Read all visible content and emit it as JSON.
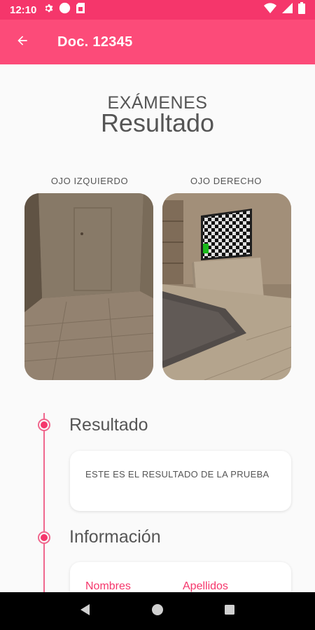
{
  "status_bar": {
    "time": "12:10",
    "left_icons": [
      "gear-icon",
      "circle-icon",
      "sim-card-icon"
    ],
    "right_icons": [
      "wifi-icon",
      "signal-icon",
      "battery-icon"
    ]
  },
  "app_bar": {
    "title": "Doc. 12345",
    "back_icon": "arrow-back-icon",
    "color": "#fc4b79",
    "status_color": "#f5366b"
  },
  "header": {
    "subtitle": "EXÁMENES",
    "title": "Resultado"
  },
  "eyes": {
    "left_label": "OJO IZQUIERDO",
    "right_label": "OJO DERECHO"
  },
  "timeline": {
    "accent": "#f5366b",
    "result_section": {
      "title": "Resultado",
      "text": "ESTE ES EL RESULTADO DE LA PRUEBA"
    },
    "info_section": {
      "title": "Información",
      "labels": [
        "Nombres",
        "Apellidos"
      ]
    }
  },
  "nav_bar": {
    "icons": [
      "back-triangle-icon",
      "home-circle-icon",
      "recents-square-icon"
    ]
  }
}
